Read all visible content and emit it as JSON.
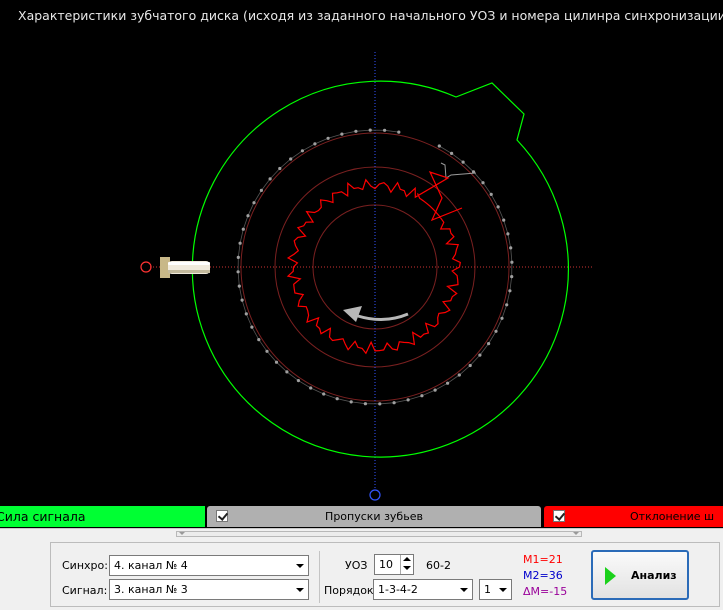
{
  "chart": {
    "title": "Характеристики зубчатого диска (исходя из заданного начального УОЗ и номера цилинра синхронизации)",
    "colors": {
      "outer_ring": "#00ff00",
      "teeth": "#999999",
      "signal": "#ff0000",
      "guide_circles": "#7a2020",
      "axis_h": "#cc3333",
      "axis_v": "#3355ff"
    }
  },
  "tabs": {
    "signal_strength": "Сила сигнала",
    "missing_teeth": "Пропуски зубьев",
    "deviation": "Отклонение ш"
  },
  "controls": {
    "sync_label": "Синхро:",
    "sync_value": "4.  канал № 4",
    "signal_label": "Сигнал:",
    "signal_value": "3.  канал № 3",
    "uoz_label": "УОЗ",
    "uoz_value": "10",
    "pattern": "60-2",
    "order_label": "Порядок",
    "order_value": "1-3-4-2",
    "cyl_value": "1",
    "m1": "M1=21",
    "m2": "M2=36",
    "dm": "ΔM=-15",
    "m1_color": "#ff0000",
    "m2_color": "#0000cc",
    "dm_color": "#990099",
    "analyze_label": "Анализ"
  }
}
